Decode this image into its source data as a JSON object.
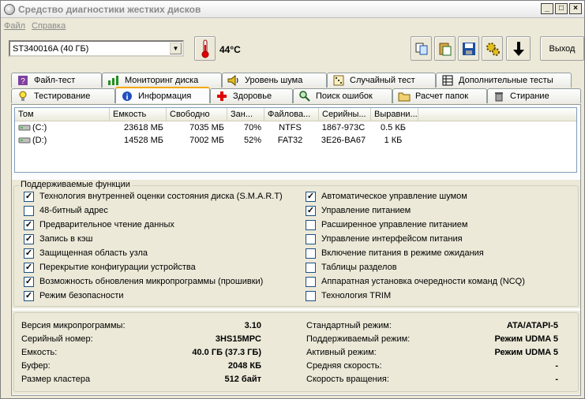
{
  "window": {
    "title": "Средство диагностики жестких дисков",
    "minimize": "_",
    "maximize": "□",
    "close": "×"
  },
  "menu": {
    "file": "Файл",
    "help": "Справка"
  },
  "toolbar": {
    "drive": "ST340016A (40 ГБ)",
    "temperature": "44°C",
    "exit": "Выход"
  },
  "tabs_row1": [
    {
      "label": "Файл-тест",
      "icon": "?"
    },
    {
      "label": "Мониторинг диска",
      "icon": "▮"
    },
    {
      "label": "Уровень шума",
      "icon": "◀"
    },
    {
      "label": "Случайный тест",
      "icon": "▦"
    },
    {
      "label": "Дополнительные тесты",
      "icon": "▤"
    }
  ],
  "tabs_row2": [
    {
      "label": "Тестирование",
      "icon": "💡"
    },
    {
      "label": "Информация",
      "icon": "i"
    },
    {
      "label": "Здоровье",
      "icon": "+"
    },
    {
      "label": "Поиск ошибок",
      "icon": "⌕"
    },
    {
      "label": "Расчет папок",
      "icon": "▭"
    },
    {
      "label": "Стирание",
      "icon": "▯"
    }
  ],
  "volumes": {
    "headers": [
      "Том",
      "Емкость",
      "Свободно",
      "Зан...",
      "Файлова...",
      "Серийны...",
      "Выравни..."
    ],
    "rows": [
      [
        "(C:)",
        "23618 МБ",
        "7035 МБ",
        "70%",
        "NTFS",
        "1867-973C",
        "0.5 КБ"
      ],
      [
        "(D:)",
        "14528 МБ",
        "7002 МБ",
        "52%",
        "FAT32",
        "3E26-BA67",
        "1 КБ"
      ]
    ]
  },
  "features": {
    "title": "Поддерживаемые функции",
    "left": [
      {
        "label": "Технология внутренней оценки состояния диска (S.M.A.R.T)",
        "checked": true
      },
      {
        "label": "48-битный адрес",
        "checked": false
      },
      {
        "label": "Предварительное чтение данных",
        "checked": true
      },
      {
        "label": "Запись в кэш",
        "checked": true
      },
      {
        "label": "Защищенная область узла",
        "checked": true
      },
      {
        "label": "Перекрытие конфигурации устройства",
        "checked": true
      },
      {
        "label": "Возможность обновления микропрограммы (прошивки)",
        "checked": true
      },
      {
        "label": "Режим безопасности",
        "checked": true
      }
    ],
    "right": [
      {
        "label": "Автоматическое управление шумом",
        "checked": true
      },
      {
        "label": "Управление питанием",
        "checked": true
      },
      {
        "label": "Расширенное управление питанием",
        "checked": false
      },
      {
        "label": "Управление интерфейсом питания",
        "checked": false
      },
      {
        "label": "Включение питания в режиме ожидания",
        "checked": false
      },
      {
        "label": "Таблицы разделов",
        "checked": false
      },
      {
        "label": "Аппаратная установка очередности команд (NCQ)",
        "checked": false
      },
      {
        "label": "Технология TRIM",
        "checked": false
      }
    ]
  },
  "info_left": [
    {
      "label": "Версия микропрограммы:",
      "value": "3.10"
    },
    {
      "label": "Серийный номер:",
      "value": "3HS15MPC"
    },
    {
      "label": "Емкость:",
      "value": "40.0 ГБ (37.3 ГБ)"
    },
    {
      "label": "Буфер:",
      "value": "2048 КБ"
    },
    {
      "label": "Размер кластера",
      "value": "512 байт"
    }
  ],
  "info_right": [
    {
      "label": "Стандартный режим:",
      "value": "ATA/ATAPI-5"
    },
    {
      "label": "Поддерживаемый режим:",
      "value": "Режим UDMA 5"
    },
    {
      "label": "Активный режим:",
      "value": "Режим UDMA 5"
    },
    {
      "label": "Средняя скорость:",
      "value": "-"
    },
    {
      "label": "Скорость вращения:",
      "value": "-"
    }
  ]
}
